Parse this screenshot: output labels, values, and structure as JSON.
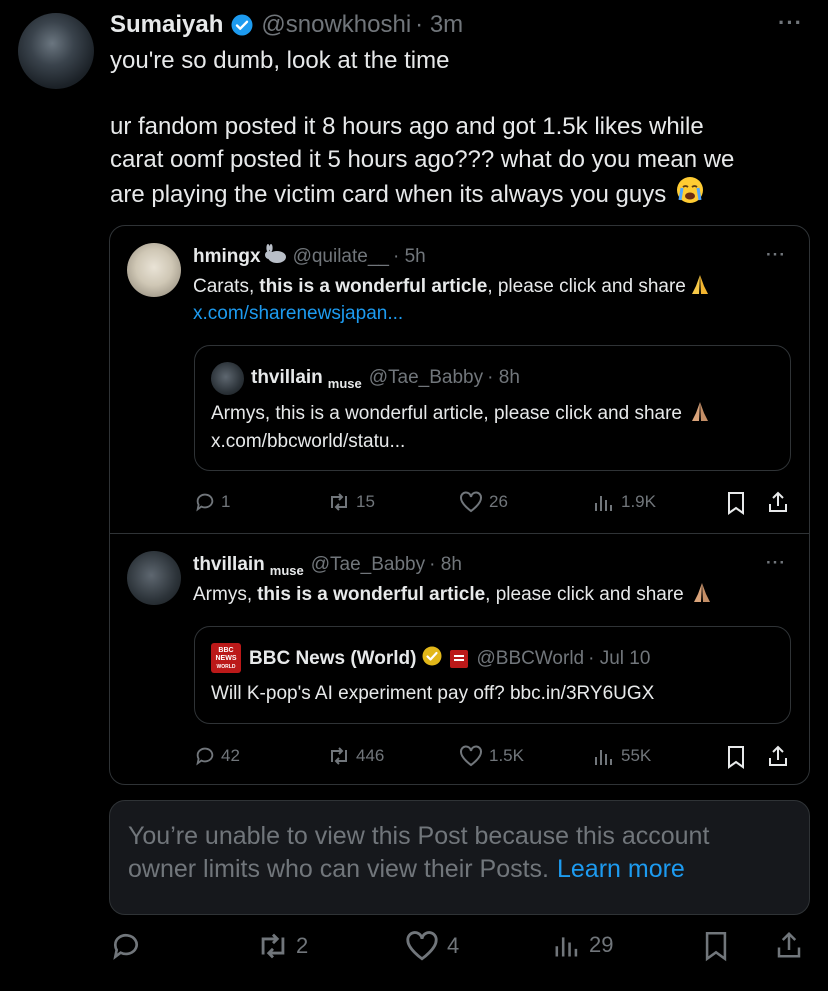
{
  "main": {
    "name": "Sumaiyah",
    "handle": "@snowkhoshi",
    "time": "· 3m",
    "line1": "you're so dumb, look at the time",
    "line2": "ur fandom posted it 8 hours ago and got 1.5k likes while",
    "line3": "carat oomf posted it 5 hours ago??? what do you mean we",
    "line4": "are playing the victim card when its always you guys",
    "more": "···",
    "actions": {
      "reply": "",
      "retweet": "2",
      "like": "4",
      "views": "29"
    }
  },
  "quote1": {
    "name": "hmingx",
    "handle": "@quilate__",
    "time": "· 5h",
    "text_before": "Carats, ",
    "text_bold": "this is a wonderful article",
    "text_after": ", please click and share",
    "link": "x.com/sharenewsjapan...",
    "more": "···",
    "actions": {
      "reply": "1",
      "retweet": "15",
      "like": "26",
      "views": "1.9K"
    }
  },
  "quote1_inner": {
    "name": "thvillain",
    "name_suffix": "muse",
    "handle": "@Tae_Babby",
    "time": "· 8h",
    "text": "Armys, this is a wonderful article, please click and share",
    "link": "x.com/bbcworld/statu..."
  },
  "quote2": {
    "name": "thvillain",
    "name_suffix": "muse",
    "handle": "@Tae_Babby",
    "time": "· 8h",
    "text_before": "Armys, ",
    "text_bold": "this is a wonderful article",
    "text_after": ", please click and share",
    "more": "···",
    "actions": {
      "reply": "42",
      "retweet": "446",
      "like": "1.5K",
      "views": "55K"
    }
  },
  "quote2_inner": {
    "name": "BBC News (World)",
    "handle": "@BBCWorld",
    "time": "· Jul 10",
    "text": "Will K-pop's AI experiment pay off? bbc.in/3RY6UGX",
    "logo_line1": "BBC",
    "logo_line2": "NEWS",
    "logo_line3": "WORLD"
  },
  "unavailable": {
    "text1": "You’re unable to view this Post because this account",
    "text2": "owner limits who can view their Posts.",
    "learn_more": "Learn more"
  },
  "colors": {
    "accent": "#1d9bf0",
    "verified_gold": "#e2b719",
    "bbc_red": "#bb1919"
  }
}
